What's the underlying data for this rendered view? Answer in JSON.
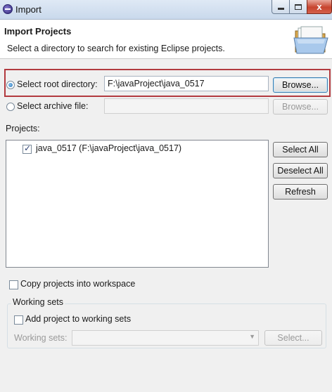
{
  "window": {
    "title": "Import",
    "controls": {
      "minimize": "",
      "maximize": "",
      "close": "x"
    }
  },
  "banner": {
    "title": "Import Projects",
    "description": "Select a directory to search for existing Eclipse projects.",
    "icon": "folder-icon"
  },
  "source": {
    "root_label": "Select root directory:",
    "root_value": "F:\\javaProject\\java_0517",
    "root_browse": "Browse...",
    "archive_label": "Select archive file:",
    "archive_value": "",
    "archive_browse": "Browse..."
  },
  "projects": {
    "label": "Projects:",
    "items": [
      {
        "label": "java_0517 (F:\\javaProject\\java_0517)",
        "checked": true
      }
    ],
    "select_all": "Select All",
    "deselect_all": "Deselect All",
    "refresh": "Refresh"
  },
  "options": {
    "copy_label": "Copy projects into workspace"
  },
  "working_sets": {
    "group_title": "Working sets",
    "add_label": "Add project to working sets",
    "sets_label": "Working sets:",
    "sets_value": "",
    "select_button": "Select..."
  },
  "colors": {
    "highlight_border": "#b23a3f",
    "title_bar": "#c9d9ec",
    "close_button": "#c7442e"
  }
}
